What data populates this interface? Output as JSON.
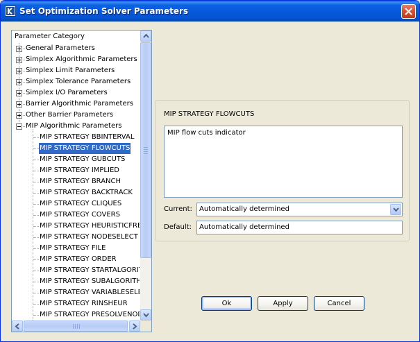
{
  "window": {
    "title": "Set Optimization Solver Parameters"
  },
  "tree": {
    "header": "Parameter Category",
    "categories": [
      {
        "label": "General Parameters",
        "expanded": false
      },
      {
        "label": "Simplex Algorithmic Parameters",
        "expanded": false
      },
      {
        "label": "Simplex Limit Parameters",
        "expanded": false
      },
      {
        "label": "Simplex Tolerance Parameters",
        "expanded": false
      },
      {
        "label": "Simplex I/O Parameters",
        "expanded": false
      },
      {
        "label": "Barrier Algorithmic Parameters",
        "expanded": false
      },
      {
        "label": "Other Barrier Parameters",
        "expanded": false
      },
      {
        "label": "MIP Algorithmic Parameters",
        "expanded": true
      }
    ],
    "children": [
      "MIP STRATEGY BBINTERVAL",
      "MIP STRATEGY FLOWCUTS",
      "MIP STRATEGY GUBCUTS",
      "MIP STRATEGY IMPLIED",
      "MIP STRATEGY BRANCH",
      "MIP STRATEGY BACKTRACK",
      "MIP STRATEGY CLIQUES",
      "MIP STRATEGY COVERS",
      "MIP STRATEGY HEURISTICFRE",
      "MIP STRATEGY NODESELECT",
      "MIP STRATEGY FILE",
      "MIP STRATEGY ORDER",
      "MIP STRATEGY STARTALGORIT",
      "MIP STRATEGY SUBALGORITH",
      "MIP STRATEGY VARIABLESELE",
      "MIP STRATEGY RINSHEUR",
      "MIP STRATEGY PRESOLVENOD"
    ],
    "selected_child": "MIP STRATEGY FLOWCUTS"
  },
  "details": {
    "title": "MIP STRATEGY FLOWCUTS",
    "description": "MIP flow cuts indicator",
    "current_label": "Current:",
    "current_value": "Automatically determined",
    "default_label": "Default:",
    "default_value": "Automatically determined"
  },
  "buttons": {
    "ok": "Ok",
    "apply": "Apply",
    "cancel": "Cancel"
  },
  "colors": {
    "titlebar": "#0657da",
    "selection": "#316ac5",
    "close": "#d75432"
  }
}
